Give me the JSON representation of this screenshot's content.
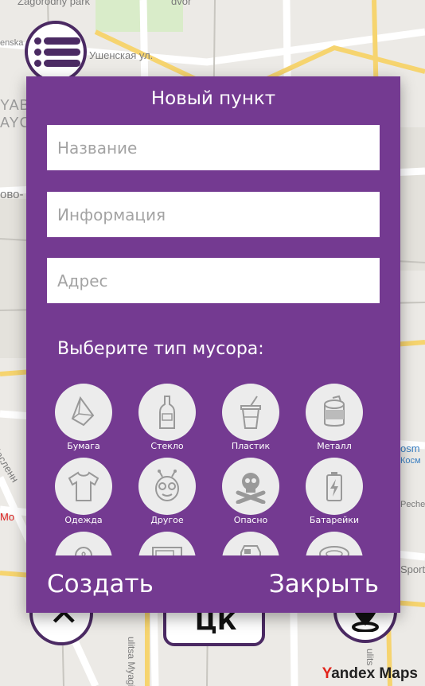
{
  "map": {
    "labels": {
      "park": "Zagorodny park",
      "dvor": "dvor",
      "street_penska": "enska",
      "street_ushenskaya": "Ушенская ул.",
      "street_vo": "ово-",
      "district_1": "YAB",
      "district_2": "AYC",
      "street_maslenn": "Масленн",
      "street_mo": "Mo",
      "street_osm": "osm",
      "street_kosm": "Косм",
      "street_pech": "Pecher",
      "street_sport": "Sport",
      "street_myagi": "ulitsa Myagi",
      "street_ulits": "ulits"
    },
    "attribution": {
      "y": "Y",
      "rest": "andex Maps"
    }
  },
  "bottom_bar": {
    "center_glyph": "ЦК",
    "left_glyph": "✕"
  },
  "dialog": {
    "title": "Новый пункт",
    "name_placeholder": "Название",
    "info_placeholder": "Информация",
    "address_placeholder": "Адрес",
    "type_prompt": "Выберите тип мусора:",
    "create_label": "Создать",
    "close_label": "Закрыть",
    "colors": {
      "accent": "#743a91",
      "dark_accent": "#4b2a63",
      "icon_bg": "#ececec"
    },
    "waste_types": [
      {
        "label": "Бумага",
        "icon": "paper-icon"
      },
      {
        "label": "Стекло",
        "icon": "glass-bottle-icon"
      },
      {
        "label": "Пластик",
        "icon": "plastic-cup-icon"
      },
      {
        "label": "Металл",
        "icon": "metal-can-icon"
      },
      {
        "label": "Одежда",
        "icon": "tshirt-icon"
      },
      {
        "label": "Другое",
        "icon": "alien-icon"
      },
      {
        "label": "Опасно",
        "icon": "skull-icon"
      },
      {
        "label": "Батарейки",
        "icon": "battery-icon"
      },
      {
        "label": "",
        "icon": "lightbulb-icon"
      },
      {
        "label": "",
        "icon": "appliance-icon"
      },
      {
        "label": "",
        "icon": "milk-carton-icon"
      },
      {
        "label": "",
        "icon": "tire-icon"
      }
    ]
  }
}
